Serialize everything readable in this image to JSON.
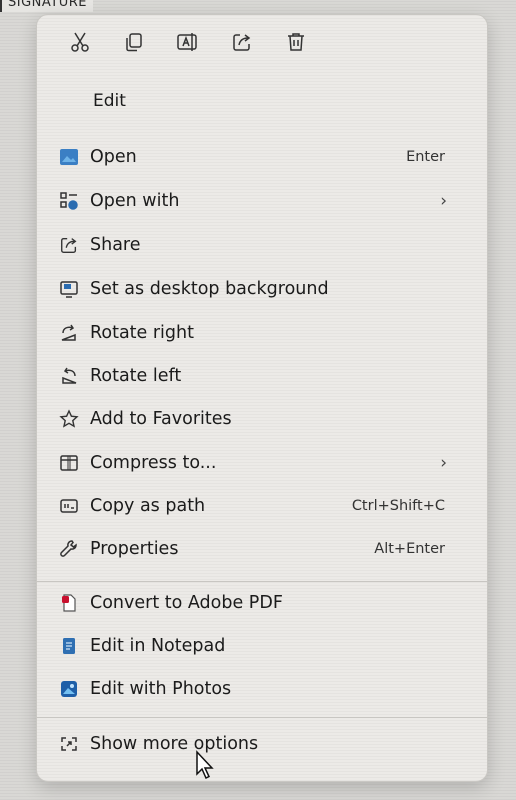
{
  "background": {
    "label": "SIGNATURE"
  },
  "quick_actions": [
    {
      "name": "cut-icon"
    },
    {
      "name": "copy-icon"
    },
    {
      "name": "rename-icon"
    },
    {
      "name": "share-icon"
    },
    {
      "name": "delete-icon"
    }
  ],
  "edit_label": "Edit",
  "items": [
    {
      "label": "Open",
      "shortcut": "Enter",
      "icon": "open-icon"
    },
    {
      "label": "Open with",
      "submenu": true,
      "icon": "open-with-icon"
    },
    {
      "label": "Share",
      "icon": "share-icon"
    },
    {
      "label": "Set as desktop background",
      "icon": "desktop-background-icon"
    },
    {
      "label": "Rotate right",
      "icon": "rotate-right-icon"
    },
    {
      "label": "Rotate left",
      "icon": "rotate-left-icon"
    },
    {
      "label": "Add to Favorites",
      "icon": "star-icon"
    },
    {
      "label": "Compress to...",
      "submenu": true,
      "icon": "compress-icon"
    },
    {
      "label": "Copy as path",
      "shortcut": "Ctrl+Shift+C",
      "icon": "copy-path-icon"
    },
    {
      "label": "Properties",
      "shortcut": "Alt+Enter",
      "icon": "wrench-icon"
    },
    {
      "label": "Convert to Adobe PDF",
      "icon": "adobe-pdf-icon"
    },
    {
      "label": "Edit in Notepad",
      "icon": "notepad-icon"
    },
    {
      "label": "Edit with Photos",
      "icon": "photos-icon"
    },
    {
      "label": "Show more options",
      "icon": "show-more-icon"
    }
  ],
  "submenu_chevron": "›"
}
